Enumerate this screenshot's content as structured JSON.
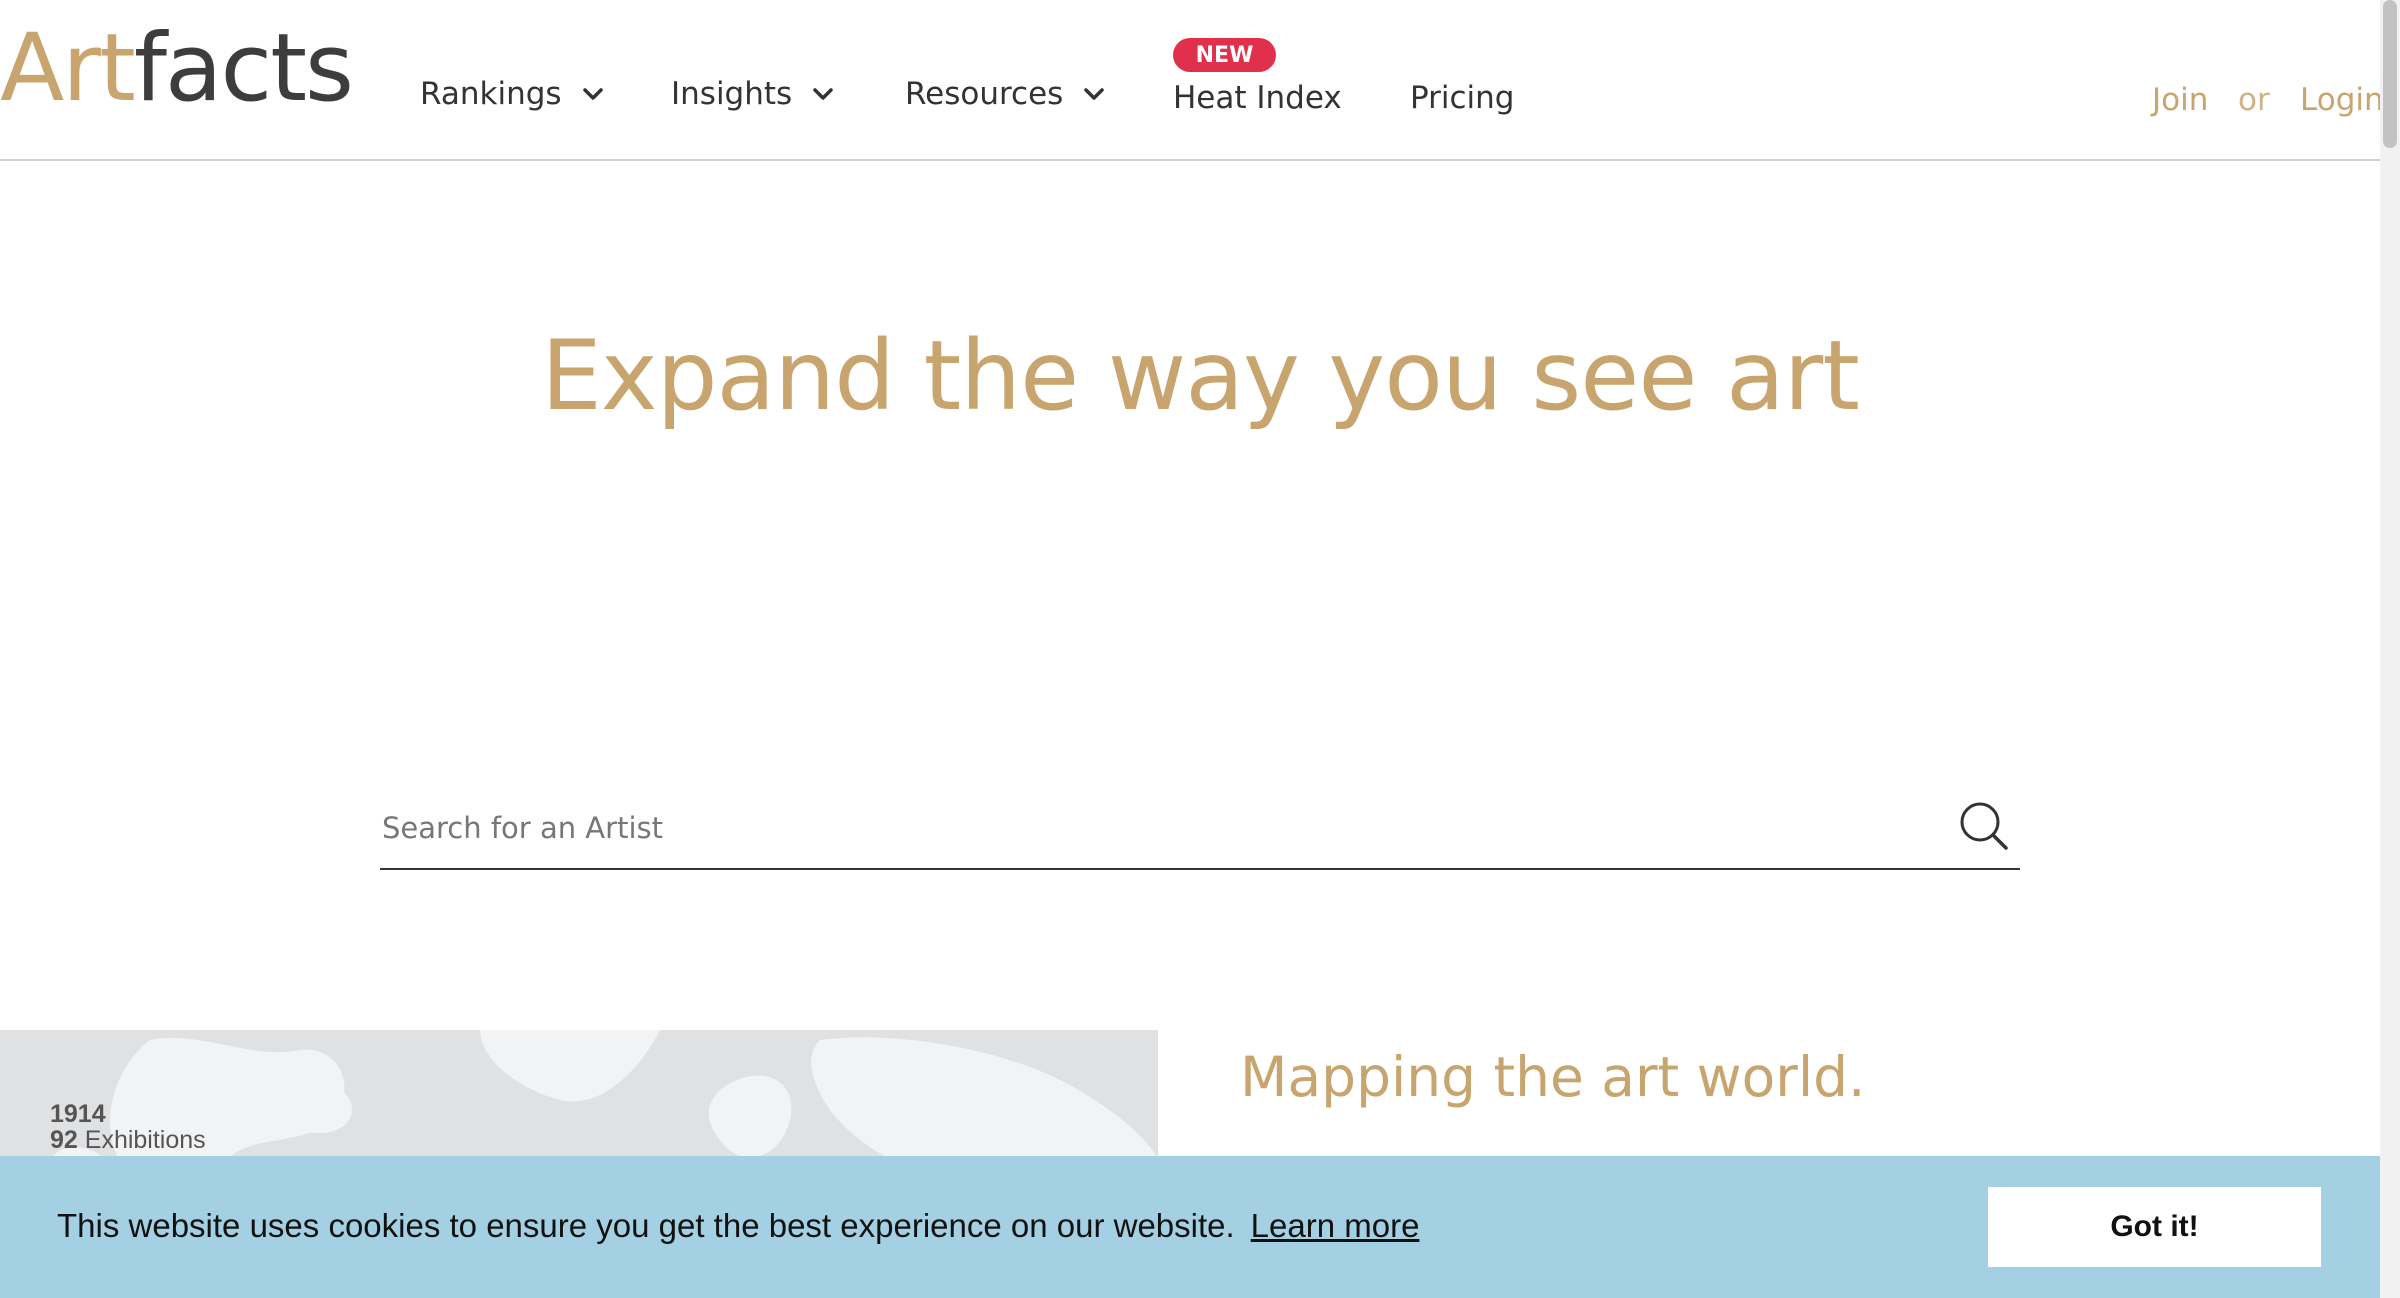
{
  "header": {
    "logo": {
      "part1": "Art",
      "part2": "facts"
    },
    "nav": [
      {
        "label": "Rankings",
        "has_dropdown": true
      },
      {
        "label": "Insights",
        "has_dropdown": true
      },
      {
        "label": "Resources",
        "has_dropdown": true
      },
      {
        "label": "Heat Index",
        "has_dropdown": false,
        "badge": "NEW"
      },
      {
        "label": "Pricing",
        "has_dropdown": false
      }
    ],
    "auth": {
      "join": "Join",
      "or": "or",
      "login": "Login"
    }
  },
  "hero": {
    "title": "Expand the way you see art",
    "search_placeholder": "Search for an Artist"
  },
  "map_preview": {
    "year": "1914",
    "exhibitions_count": "92",
    "exhibitions_label": "Exhibitions"
  },
  "mapping": {
    "heading": "Mapping the art world."
  },
  "cookie": {
    "message": "This website uses cookies to ensure you get the best experience on our website.",
    "link": "Learn more",
    "button": "Got it!"
  },
  "colors": {
    "brand_gold": "#c8a56f",
    "badge_red": "#e0304b",
    "cookie_bg": "#a3d0e2",
    "map_bg": "#dfe1e3"
  },
  "icons": [
    "chevron-down-icon",
    "search-icon"
  ]
}
